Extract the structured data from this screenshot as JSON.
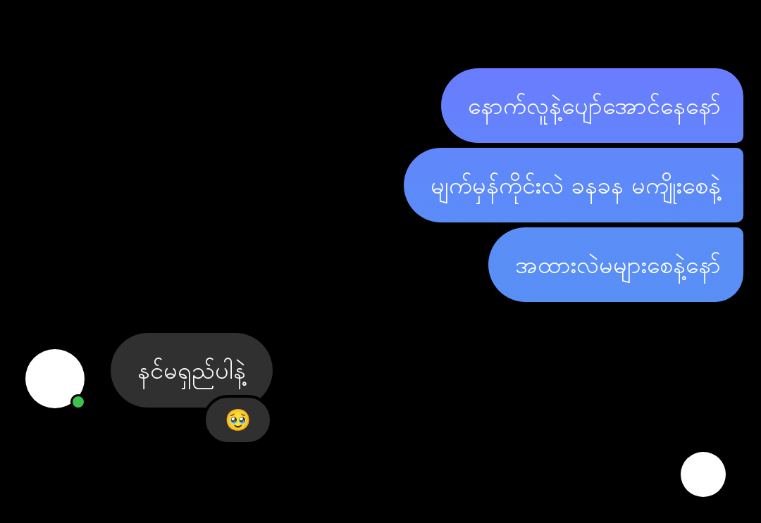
{
  "sent_messages": [
    {
      "text": "နောက်လူနဲ့ပျော်အောင်နေနော်"
    },
    {
      "text": "မျက်မှန်ကိုင်းလဲ ခနခန မကျိုးစေနဲ့"
    },
    {
      "text": "အထားလဲမများစေနဲ့နော်"
    }
  ],
  "received_message": {
    "text": "နင်မရှည်ပါနဲ့",
    "reaction": "🥹",
    "sender_online": true
  },
  "seen_indicator": true
}
